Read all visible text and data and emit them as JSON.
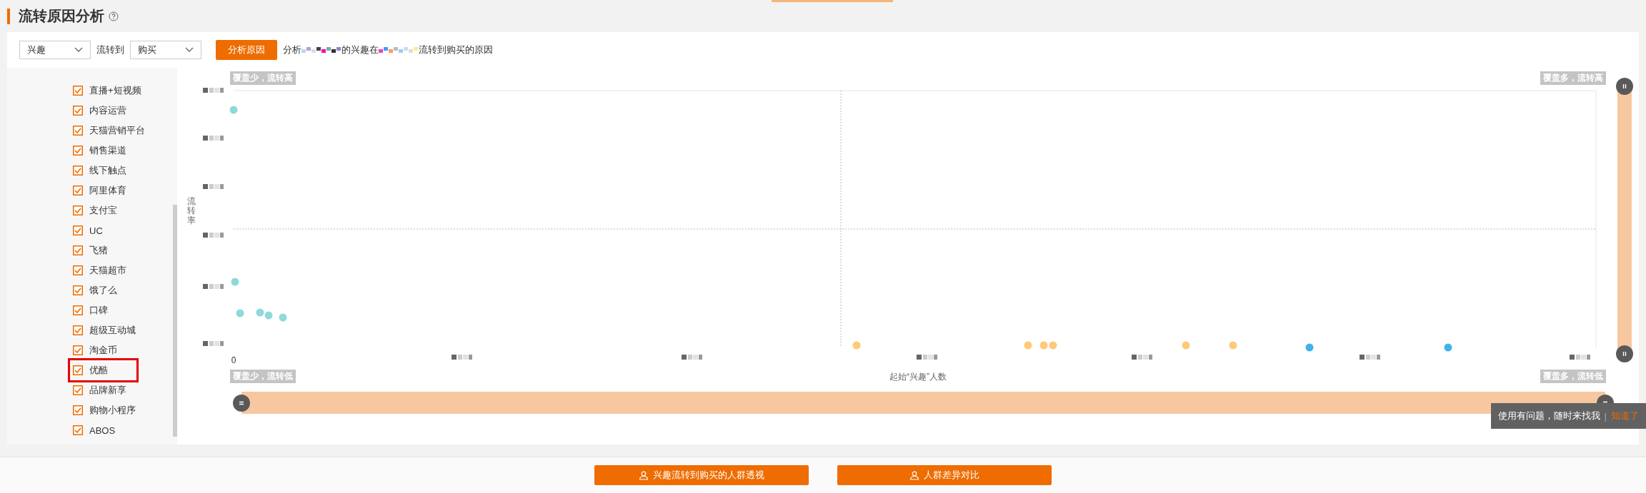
{
  "page_title": "流转原因分析",
  "controls": {
    "from_select": "兴趣",
    "flow_label": "流转到",
    "to_select": "购买",
    "analyze_button": "分析原因",
    "description": [
      "分析",
      "的兴趣在",
      "流转到购买的原因"
    ]
  },
  "channels": [
    {
      "label": "直播+短视频",
      "checked": true,
      "highlighted": false
    },
    {
      "label": "内容运营",
      "checked": true,
      "highlighted": false
    },
    {
      "label": "天猫营销平台",
      "checked": true,
      "highlighted": false
    },
    {
      "label": "销售渠道",
      "checked": true,
      "highlighted": false
    },
    {
      "label": "线下触点",
      "checked": true,
      "highlighted": false
    },
    {
      "label": "阿里体育",
      "checked": true,
      "highlighted": false
    },
    {
      "label": "支付宝",
      "checked": true,
      "highlighted": false
    },
    {
      "label": "UC",
      "checked": true,
      "highlighted": false
    },
    {
      "label": "飞猪",
      "checked": true,
      "highlighted": false
    },
    {
      "label": "天猫超市",
      "checked": true,
      "highlighted": false
    },
    {
      "label": "饿了么",
      "checked": true,
      "highlighted": false
    },
    {
      "label": "口碑",
      "checked": true,
      "highlighted": false
    },
    {
      "label": "超级互动城",
      "checked": true,
      "highlighted": false
    },
    {
      "label": "淘金币",
      "checked": true,
      "highlighted": false
    },
    {
      "label": "优酷",
      "checked": true,
      "highlighted": true
    },
    {
      "label": "品牌新享",
      "checked": true,
      "highlighted": false
    },
    {
      "label": "购物小程序",
      "checked": true,
      "highlighted": false
    },
    {
      "label": "ABOS",
      "checked": true,
      "highlighted": false
    }
  ],
  "chart": {
    "quadrant_labels": {
      "top_left": "覆盖少，流转高",
      "top_right": "覆盖多，流转高",
      "bottom_left": "覆盖少，流转低",
      "bottom_right": "覆盖多，流转低"
    },
    "y_axis_label": "流转率",
    "x_axis_label": "起始“兴趣”人数",
    "x_origin_label": "0"
  },
  "vertical_slider": {
    "level": 1
  },
  "horizontal_slider": {
    "level": 1
  },
  "tooltip": {
    "text": "使用有问题，随时来找我",
    "separator": "|",
    "link": "知道了"
  },
  "footer_buttons": [
    "兴趣流转到购买的人群透视",
    "人群差异对比"
  ]
}
